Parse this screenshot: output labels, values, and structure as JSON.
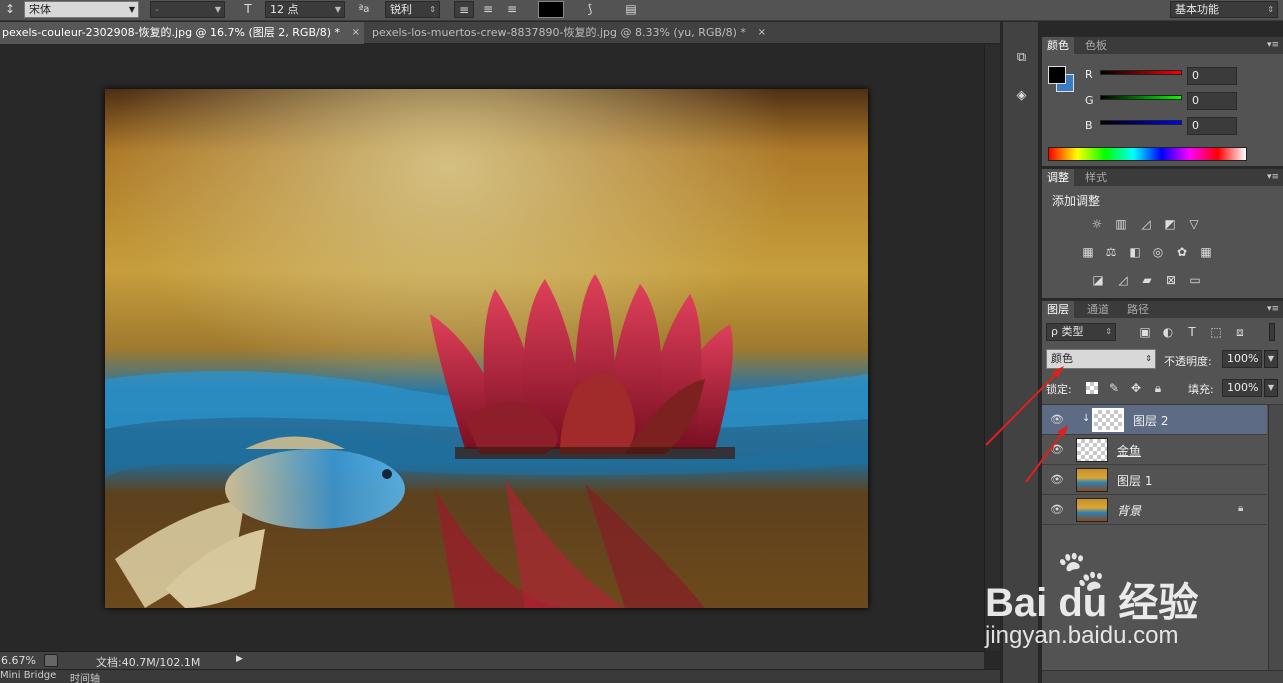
{
  "options_bar": {
    "font_family": "宋体",
    "font_style": "-",
    "font_size": "12 点",
    "aa_label": "ªa",
    "antialias": "锐利",
    "workspace": "基本功能"
  },
  "tabs": [
    {
      "label": "pexels-couleur-2302908-恢复的.jpg @ 16.7% (图层 2, RGB/8) *",
      "close": "×"
    },
    {
      "label": "pexels-los-muertos-crew-8837890-恢复的.jpg @ 8.33% (yu, RGB/8) *",
      "close": "×"
    }
  ],
  "status": {
    "zoom": "6.67%",
    "doc_info": "文档:40.7M/102.1M"
  },
  "bottom_tabs": [
    "Mini Bridge",
    "时间轴"
  ],
  "color_panel": {
    "tabs": [
      "颜色",
      "色板"
    ],
    "r_label": "R",
    "g_label": "G",
    "b_label": "B",
    "r_value": "0",
    "g_value": "0",
    "b_value": "0"
  },
  "adjust_panel": {
    "tabs": [
      "调整",
      "样式"
    ],
    "heading": "添加调整"
  },
  "layers_panel": {
    "tabs": [
      "图层",
      "通道",
      "路径"
    ],
    "filter_kind": "ρ 类型",
    "blend_mode": "颜色",
    "opacity_label": "不透明度:",
    "opacity_value": "100%",
    "lock_label": "锁定:",
    "fill_label": "填充:",
    "fill_value": "100%",
    "layers": [
      {
        "name": "图层 2",
        "selected": true
      },
      {
        "name": "金鱼",
        "selected": false
      },
      {
        "name": "图层 1",
        "selected": false
      },
      {
        "name": "背景",
        "selected": false
      }
    ]
  },
  "watermark": {
    "brand": "Bai du 经验",
    "url": "jingyan.baidu.com"
  },
  "colors": {
    "accent_selected_layer": "#5e6b84",
    "annotation_arrow": "#e0201a"
  }
}
